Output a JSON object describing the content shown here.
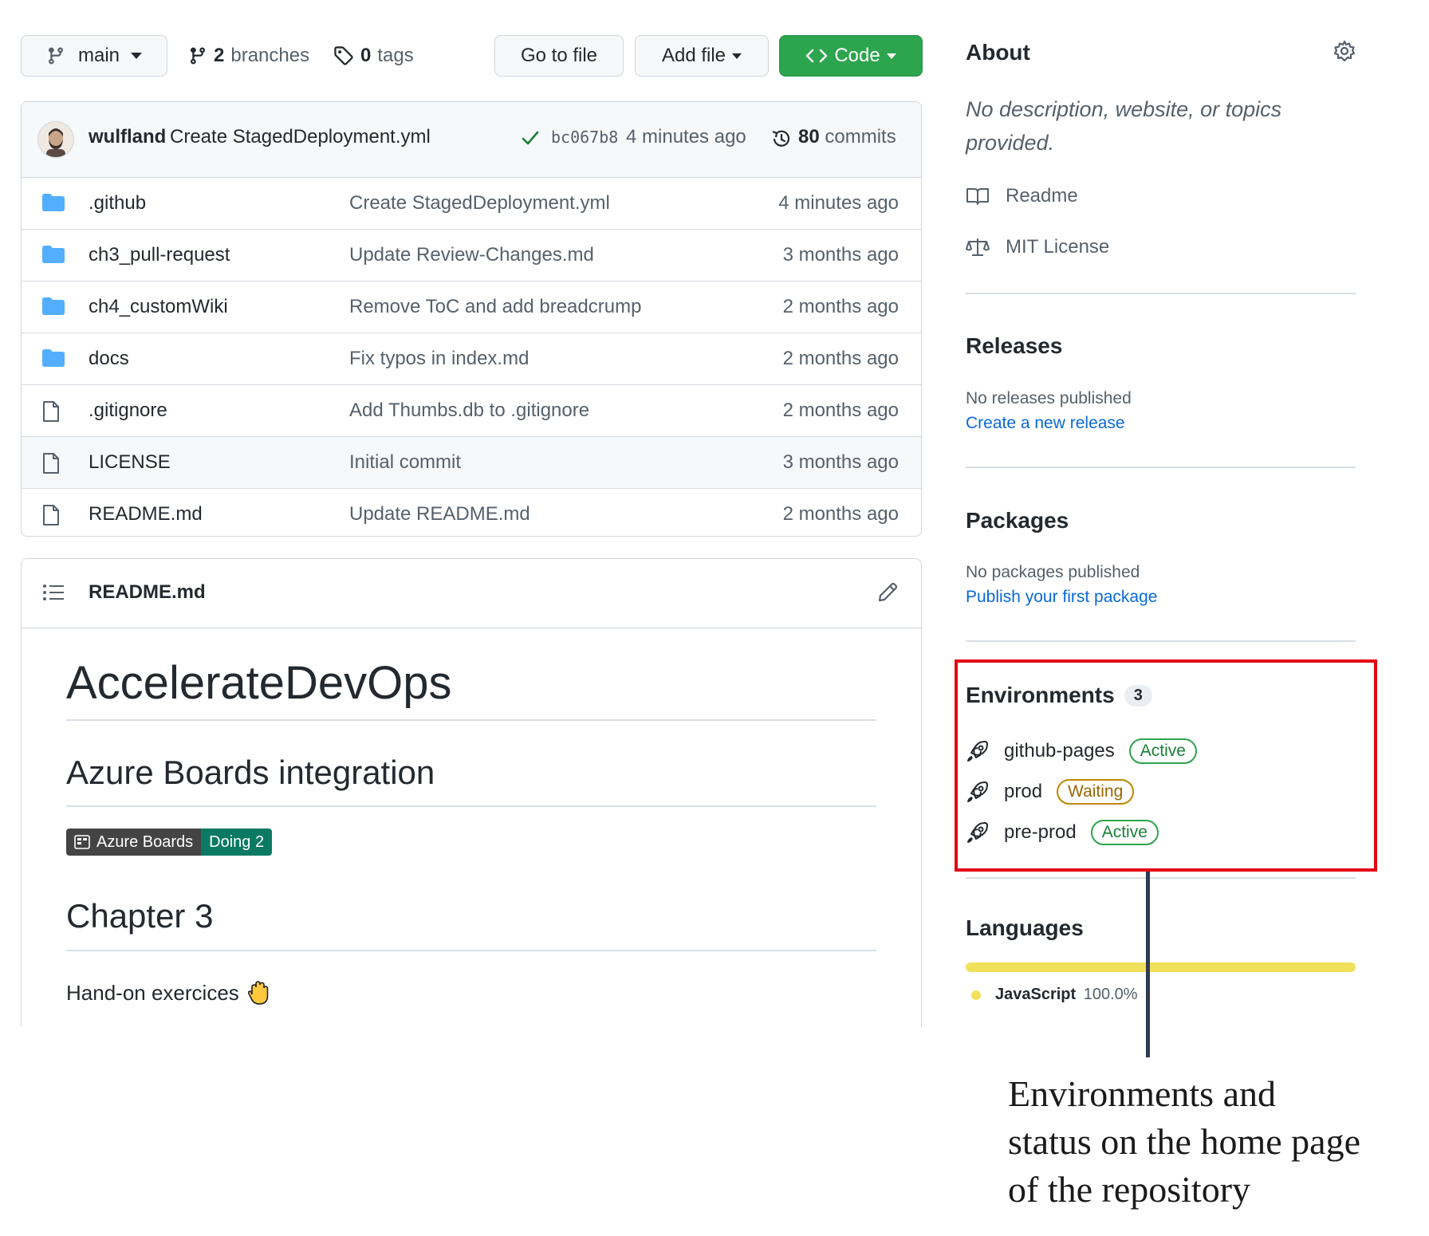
{
  "toolbar": {
    "branch": "main",
    "branches_count": "2",
    "branches_label": "branches",
    "tags_count": "0",
    "tags_label": "tags",
    "go_to_file": "Go to file",
    "add_file": "Add file",
    "code": "Code"
  },
  "commit": {
    "author": "wulfland",
    "message": "Create StagedDeployment.yml",
    "sha": "bc067b8",
    "time": "4 minutes ago",
    "commits_count": "80",
    "commits_label": "commits"
  },
  "files": [
    {
      "type": "dir",
      "name": ".github",
      "message": "Create StagedDeployment.yml",
      "age": "4 minutes ago"
    },
    {
      "type": "dir",
      "name": "ch3_pull-request",
      "message": "Update Review-Changes.md",
      "age": "3 months ago"
    },
    {
      "type": "dir",
      "name": "ch4_customWiki",
      "message": "Remove ToC and add breadcrump",
      "age": "2 months ago"
    },
    {
      "type": "dir",
      "name": "docs",
      "message": "Fix typos in index.md",
      "age": "2 months ago"
    },
    {
      "type": "file",
      "name": ".gitignore",
      "message": "Add Thumbs.db to .gitignore",
      "age": "2 months ago"
    },
    {
      "type": "file",
      "name": "LICENSE",
      "message": "Initial commit",
      "age": "3 months ago"
    },
    {
      "type": "file",
      "name": "README.md",
      "message": "Update README.md",
      "age": "2 months ago"
    }
  ],
  "readme": {
    "filename": "README.md",
    "title": "AccelerateDevOps",
    "section1": "Azure Boards integration",
    "badge_left": "Azure Boards",
    "badge_right": "Doing 2",
    "section2": "Chapter 3",
    "paragraph": "Hand-on exercices"
  },
  "about": {
    "title": "About",
    "description_line1": "No description, website, or topics",
    "description_line2": "provided.",
    "readme": "Readme",
    "license": "MIT License"
  },
  "releases": {
    "title": "Releases",
    "none": "No releases published",
    "link": "Create a new release"
  },
  "packages": {
    "title": "Packages",
    "none": "No packages published",
    "link": "Publish your first package"
  },
  "environments": {
    "title": "Environments",
    "count": "3",
    "items": [
      {
        "name": "github-pages",
        "status": "Active"
      },
      {
        "name": "prod",
        "status": "Waiting"
      },
      {
        "name": "pre-prod",
        "status": "Active"
      }
    ]
  },
  "languages": {
    "title": "Languages",
    "items": [
      {
        "name": "JavaScript",
        "percent": "100.0%",
        "share": 1.0,
        "color": "#f1e05a"
      }
    ]
  },
  "caption": {
    "line1": "Environments and",
    "line2": "status on the home page",
    "line3": "of the repository"
  },
  "colors": {
    "active": "#1a7f37",
    "waiting": "#9a6700",
    "highlight": "#e30613",
    "folder": "#54aeff",
    "link": "#0969da"
  }
}
